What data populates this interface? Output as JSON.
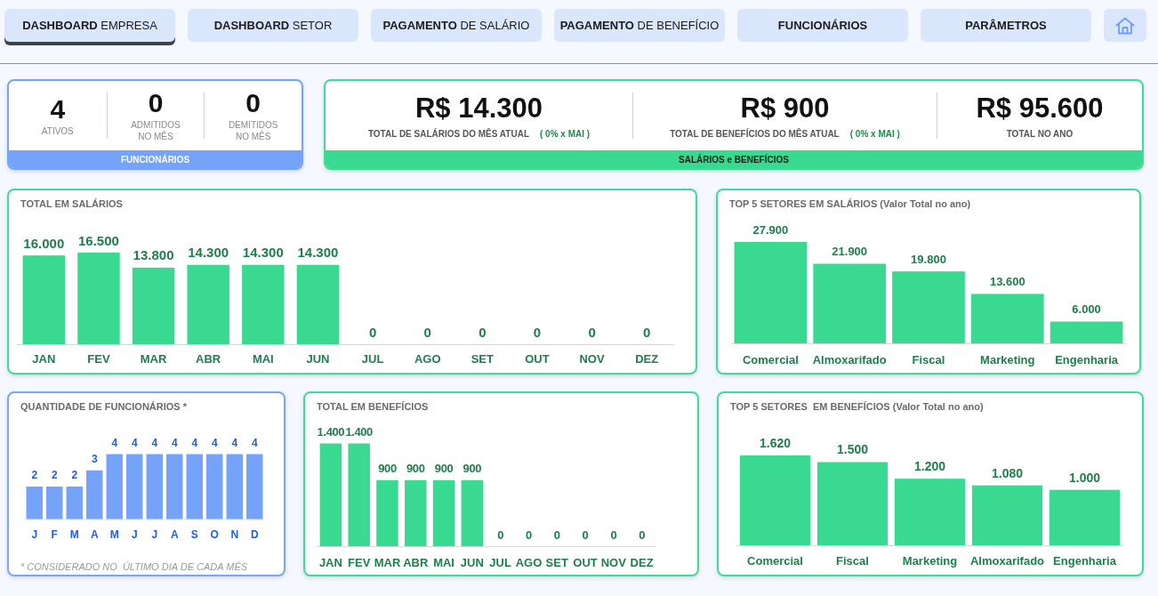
{
  "nav": {
    "tabs": [
      {
        "label": "DASHBOARD",
        "detail": "EMPRESA",
        "selected": true
      },
      {
        "label": "DASHBOARD",
        "detail": "SETOR",
        "selected": false
      },
      {
        "label": "PAGAMENTO",
        "detail": "DE SALÁRIO",
        "selected": false
      },
      {
        "label": "PAGAMENTO",
        "detail": "DE BENEFÍCIO",
        "selected": false
      },
      {
        "label": "FUNCIONÁRIOS",
        "selected": false
      },
      {
        "label": "PARÂMETROS",
        "selected": false
      }
    ]
  },
  "employees_card": {
    "footer": "FUNCIONÁRIOS",
    "stats": [
      {
        "value": "4",
        "label": "ATIVOS"
      },
      {
        "value": "0",
        "label": "ADMITIDOS NO MÊS"
      },
      {
        "value": "0",
        "label": "DEMITIDOS NO MÊS"
      }
    ]
  },
  "payroll_card": {
    "footer": "SALÁRIOS e BENEFÍCIOS",
    "stats": [
      {
        "value": "R$ 14.300",
        "label": "TOTAL DE SALÁRIOS DO MÊS ATUAL",
        "change": "( 0% x MAI )"
      },
      {
        "value": "R$ 900",
        "label": "TOTAL DE BENEFÍCIOS DO MÊS ATUAL",
        "change": "( 0% x MAI )"
      },
      {
        "value": "R$ 95.600",
        "label": "TOTAL NO ANO"
      }
    ]
  },
  "salary_chart": {
    "title": "TOTAL EM SALÁRIOS",
    "chart_data": {
      "type": "bar",
      "categories": [
        "JAN",
        "FEV",
        "MAR",
        "ABR",
        "MAI",
        "JUN",
        "JUL",
        "AGO",
        "SET",
        "OUT",
        "NOV",
        "DEZ"
      ],
      "values": [
        16000,
        16500,
        13800,
        14300,
        14300,
        14300,
        0,
        0,
        0,
        0,
        0,
        0
      ],
      "value_labels": [
        "16.000",
        "16.500",
        "13.800",
        "14.300",
        "14.300",
        "14.300",
        "0",
        "0",
        "0",
        "0",
        "0",
        "0"
      ]
    }
  },
  "sector_salary_chart": {
    "title": "TOP 5 SETORES EM SALÁRIOS (Valor Total no ano)",
    "chart_data": {
      "type": "bar",
      "categories": [
        "Comercial",
        "Almoxarifado",
        "Fiscal",
        "Marketing",
        "Engenharia"
      ],
      "values": [
        27900,
        21900,
        19800,
        13600,
        6000
      ],
      "value_labels": [
        "27.900",
        "21.900",
        "19.800",
        "13.600",
        "6.000"
      ]
    }
  },
  "headcount_chart": {
    "title": "QUANTIDADE DE FUNCIONÁRIOS *",
    "chart_data": {
      "type": "bar",
      "categories": [
        "J",
        "F",
        "M",
        "A",
        "M",
        "J",
        "J",
        "A",
        "S",
        "O",
        "N",
        "D"
      ],
      "values": [
        2,
        2,
        2,
        3,
        4,
        4,
        4,
        4,
        4,
        4,
        4,
        4
      ],
      "value_labels": [
        "2",
        "2",
        "2",
        "3",
        "4",
        "4",
        "4",
        "4",
        "4",
        "4",
        "4",
        "4"
      ]
    },
    "footnote": "* CONSIDERADO NO  ÚLTIMO DIA DE CADA MÊS"
  },
  "benefit_chart": {
    "title": "TOTAL EM BENEFÍCIOS",
    "chart_data": {
      "type": "bar",
      "categories": [
        "JAN",
        "FEV",
        "MAR",
        "ABR",
        "MAI",
        "JUN",
        "JUL",
        "AGO",
        "SET",
        "OUT",
        "NOV",
        "DEZ"
      ],
      "values": [
        1400,
        1400,
        900,
        900,
        900,
        900,
        0,
        0,
        0,
        0,
        0,
        0
      ],
      "value_labels": [
        "1.400",
        "1.400",
        "900",
        "900",
        "900",
        "900",
        "0",
        "0",
        "0",
        "0",
        "0",
        "0"
      ]
    }
  },
  "sector_benefit_chart": {
    "title": "TOP 5 SETORES  EM BENEFÍCIOS (Valor Total no ano)",
    "chart_data": {
      "type": "bar",
      "categories": [
        "Comercial",
        "Fiscal",
        "Marketing",
        "Almoxarifado",
        "Engenharia"
      ],
      "values": [
        1620,
        1500,
        1200,
        1080,
        1000
      ],
      "value_labels": [
        "1.620",
        "1.500",
        "1.200",
        "1.080",
        "1.000"
      ]
    }
  }
}
